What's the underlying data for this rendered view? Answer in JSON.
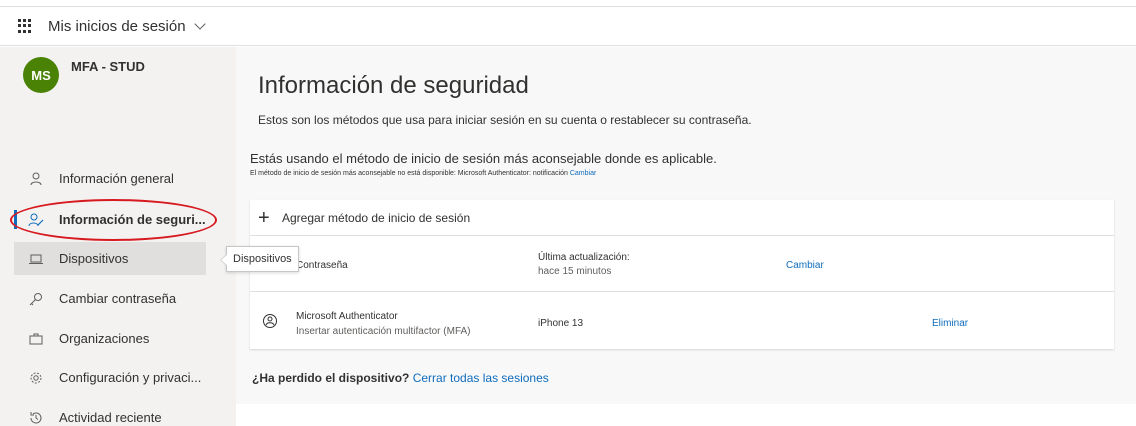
{
  "header": {
    "app_title": "Mis inicios de sesión"
  },
  "user": {
    "initials": "MS",
    "name": "MFA - STUD",
    "avatar_color": "#498205"
  },
  "sidebar": {
    "items": [
      {
        "label": "Información general",
        "icon": "person-icon"
      },
      {
        "label": "Información de seguri...",
        "icon": "person-key-icon"
      },
      {
        "label": "Dispositivos",
        "icon": "laptop-icon"
      },
      {
        "label": "Cambiar contraseña",
        "icon": "key-icon"
      },
      {
        "label": "Organizaciones",
        "icon": "briefcase-icon"
      },
      {
        "label": "Configuración y privaci...",
        "icon": "gear-icon"
      },
      {
        "label": "Actividad reciente",
        "icon": "history-icon"
      }
    ],
    "tooltip": "Dispositivos"
  },
  "main": {
    "title": "Información de seguridad",
    "subtitle": "Estos son los métodos que usa para iniciar sesión en su cuenta o restablecer su contraseña.",
    "default_line": "Estás usando el método de inicio de sesión más aconsejable donde es aplicable.",
    "default_note": "El método de inicio de sesión más aconsejable no está disponible: Microsoft Authenticator: notificación",
    "default_note_link": "Cambiar",
    "add_method": "Agregar método de inicio de sesión",
    "methods": [
      {
        "name": "Contraseña",
        "detail_label": "Última actualización:",
        "detail_value": "hace 15 minutos",
        "action": "Cambiar"
      },
      {
        "name": "Microsoft Authenticator",
        "description": "Insertar autenticación multifactor (MFA)",
        "detail_value": "iPhone 13",
        "action": "Eliminar"
      }
    ],
    "lost_device_question": "¿Ha perdido el dispositivo?",
    "lost_device_link": "Cerrar todas las sesiones"
  },
  "colors": {
    "accent": "#0f6cbd",
    "annotation": "#d71920"
  }
}
